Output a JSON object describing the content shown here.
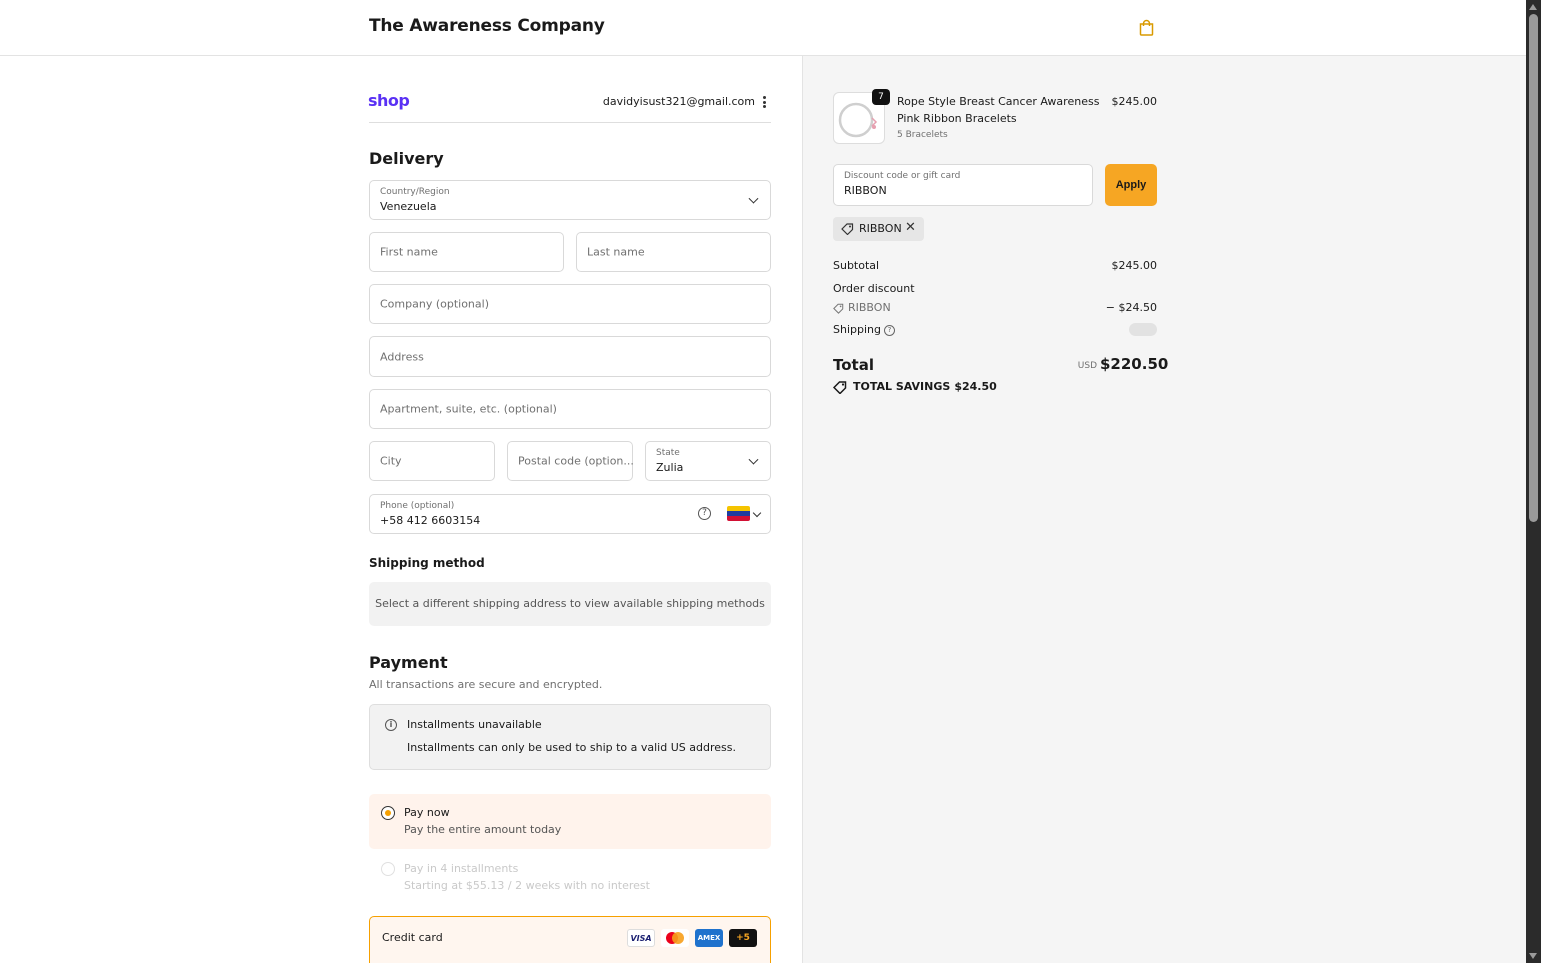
{
  "header": {
    "store_name": "The Awareness Company",
    "cart_icon": "shopping-bag-icon"
  },
  "account": {
    "logo": "shop",
    "email": "davidyisust321@gmail.com"
  },
  "delivery": {
    "title": "Delivery",
    "country_label": "Country/Region",
    "country_value": "Venezuela",
    "first_name_placeholder": "First name",
    "last_name_placeholder": "Last name",
    "company_placeholder": "Company (optional)",
    "address_placeholder": "Address",
    "apartment_placeholder": "Apartment, suite, etc. (optional)",
    "city_placeholder": "City",
    "postal_placeholder": "Postal code (option...",
    "state_label": "State",
    "state_value": "Zulia",
    "phone_label": "Phone (optional)",
    "phone_value": "+58 412 6603154",
    "help_glyph": "?"
  },
  "shipping_method": {
    "title": "Shipping method",
    "message": "Select a different shipping address to view available shipping methods"
  },
  "payment": {
    "title": "Payment",
    "subtitle": "All transactions are secure and encrypted.",
    "installments_title": "Installments unavailable",
    "installments_desc": "Installments can only be used to ship to a valid US address.",
    "info_glyph": "i",
    "pay_now_title": "Pay now",
    "pay_now_desc": "Pay the entire amount today",
    "pay_installments_title": "Pay in 4 installments",
    "pay_installments_desc": "Starting at $55.13 / 2 weeks with no interest",
    "credit_card_label": "Credit card",
    "card_brands": [
      "VISA",
      "",
      "AMEX",
      "+5"
    ]
  },
  "order": {
    "quantity": "7",
    "product_name": "Rope Style Breast Cancer Awareness Pink Ribbon Bracelets",
    "product_variant": "5 Bracelets",
    "product_price": "$245.00",
    "discount_label": "Discount code or gift card",
    "discount_value": "RIBBON",
    "apply_label": "Apply",
    "applied_code": "RIBBON",
    "subtotal_label": "Subtotal",
    "subtotal_value": "$245.00",
    "order_discount_label": "Order discount",
    "discount_code_line": "RIBBON",
    "discount_amount": "− $24.50",
    "shipping_label": "Shipping",
    "total_label": "Total",
    "currency": "USD",
    "total_value": "$220.50",
    "savings_label": "TOTAL SAVINGS",
    "savings_value": "$24.50"
  },
  "colors": {
    "accent": "#f6a623",
    "shop_purple": "#5a31f4",
    "pay_now_bg": "#fff3ec"
  }
}
